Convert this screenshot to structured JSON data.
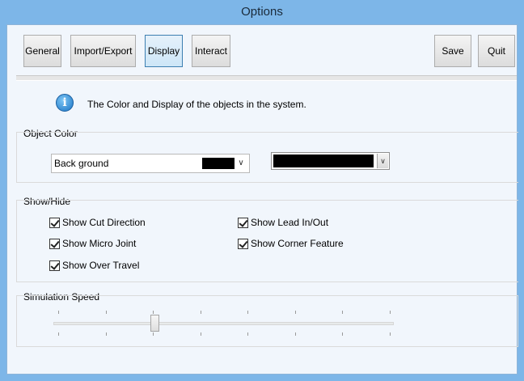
{
  "window": {
    "title": "Options"
  },
  "toolbar": {
    "general": "General",
    "import_export": "Import/Export",
    "display": "Display",
    "interact": "Interact",
    "save": "Save",
    "quit": "Quit",
    "active_tab": "Display"
  },
  "info": {
    "icon": "info-icon",
    "text": "The Color and Display of the objects in the system."
  },
  "object_color": {
    "label": "Object Color",
    "selected_item": "Back ground",
    "selected_color": "#000000"
  },
  "show_hide": {
    "label": "Show/Hide",
    "options": [
      {
        "label": "Show Cut Direction",
        "checked": true
      },
      {
        "label": "Show Lead In/Out",
        "checked": true
      },
      {
        "label": "Show Micro Joint",
        "checked": true
      },
      {
        "label": "Show Corner Feature",
        "checked": true
      },
      {
        "label": "Show Over Travel",
        "checked": true
      }
    ]
  },
  "simulation_speed": {
    "label": "Simulation Speed",
    "tick_count": 8,
    "value_fraction": 0.29
  }
}
